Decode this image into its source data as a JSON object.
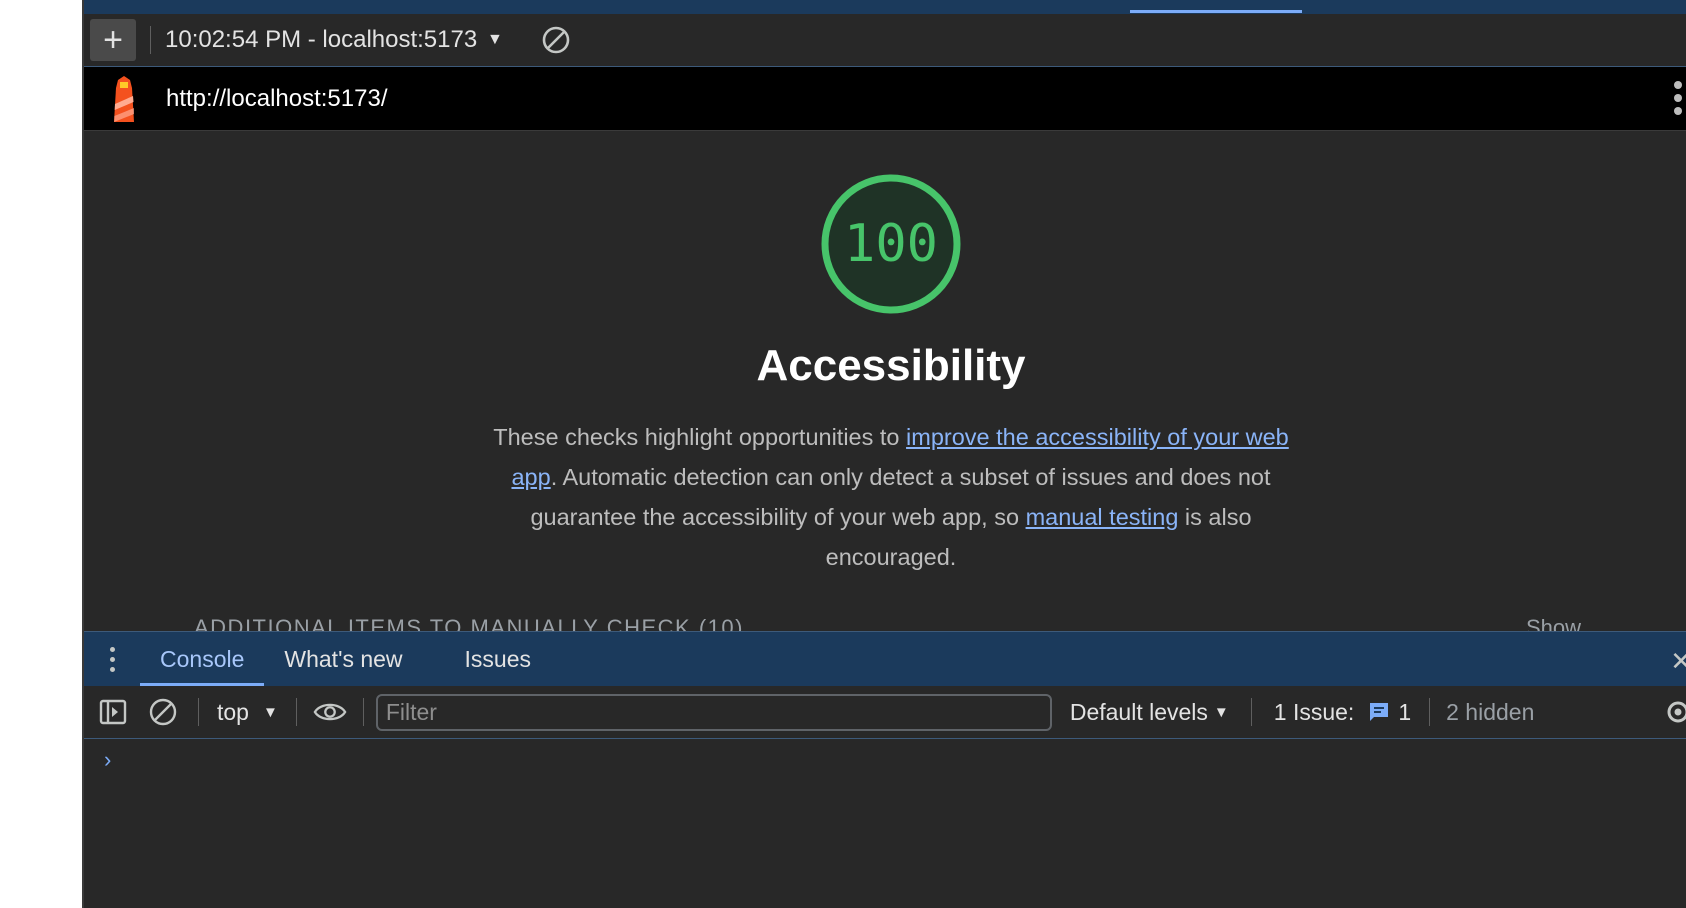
{
  "lighthouse": {
    "new_report_label": "+",
    "report_selector": "10:02:54 PM - localhost:5173",
    "url": "http://localhost:5173/"
  },
  "report": {
    "score": "100",
    "category_title": "Accessibility",
    "desc_part1": "These checks highlight opportunities to ",
    "desc_link1": "improve the accessibility of your web app",
    "desc_part2": ". Automatic detection can only detect a subset of issues and does not guarantee the accessibility of your web app, so ",
    "desc_link2": "manual testing",
    "desc_part3": " is also encouraged.",
    "manual_items_header": "ADDITIONAL ITEMS TO MANUALLY CHECK (10)",
    "show_label": "Show",
    "score_fraction": 1.0,
    "score_color": "#47c46a"
  },
  "drawer": {
    "tabs": [
      {
        "label": "Console",
        "active": true
      },
      {
        "label": "What's new",
        "active": false
      },
      {
        "label": "Issues",
        "active": false
      }
    ],
    "close_label": "✕"
  },
  "console": {
    "context": "top",
    "filter_placeholder": "Filter",
    "filter_value": "",
    "levels": "Default levels",
    "issues_label": "1 Issue:",
    "issues_count": "1",
    "hidden": "2 hidden",
    "prompt": "›"
  },
  "colors": {
    "accent": "#7cacf8",
    "panel_bg": "#282828",
    "tabbar_bg": "#1b3a5c",
    "score_green": "#47c46a"
  }
}
